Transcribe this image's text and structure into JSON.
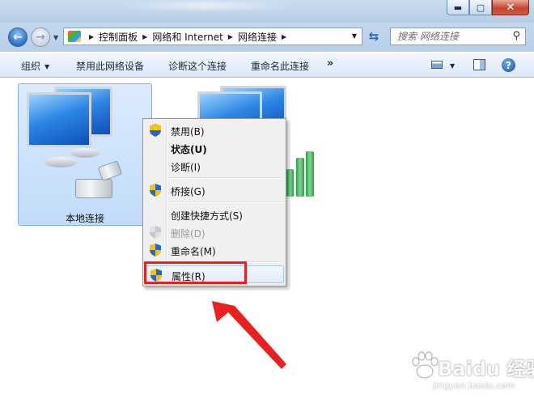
{
  "window": {
    "min_glyph": "▬",
    "max_glyph": "▢",
    "close_glyph": "✕"
  },
  "address": {
    "crumbs": [
      "控制面板",
      "网络和 Internet",
      "网络连接"
    ],
    "search_placeholder": "搜索 网络连接"
  },
  "command_bar": {
    "organize": "组织",
    "disable_device": "禁用此网络设备",
    "diagnose": "诊断这个连接",
    "rename": "重命名此连接",
    "more": "»"
  },
  "connections": [
    {
      "label": "本地连接",
      "selected": true
    },
    {
      "label": "",
      "selected": false
    }
  ],
  "context_menu": {
    "items": [
      {
        "label": "禁用(B)",
        "shield": true,
        "bold": false,
        "disabled": false
      },
      {
        "label": "状态(U)",
        "shield": false,
        "bold": true,
        "disabled": false
      },
      {
        "label": "诊断(I)",
        "shield": false,
        "bold": false,
        "disabled": false
      },
      {
        "label": "桥接(G)",
        "shield": true,
        "bold": false,
        "disabled": false
      },
      {
        "label": "创建快捷方式(S)",
        "shield": false,
        "bold": false,
        "disabled": false
      },
      {
        "label": "删除(D)",
        "shield": true,
        "bold": false,
        "disabled": true
      },
      {
        "label": "重命名(M)",
        "shield": true,
        "bold": false,
        "disabled": false
      },
      {
        "label": "属性(R)",
        "shield": true,
        "bold": false,
        "disabled": false,
        "highlighted": true
      }
    ]
  },
  "annotation": {
    "highlight_color": "#e8201f",
    "arrow_color": "#e8201f"
  },
  "watermark": {
    "text": "Baidu 经验",
    "sub": "jingyan.baidu.com"
  }
}
